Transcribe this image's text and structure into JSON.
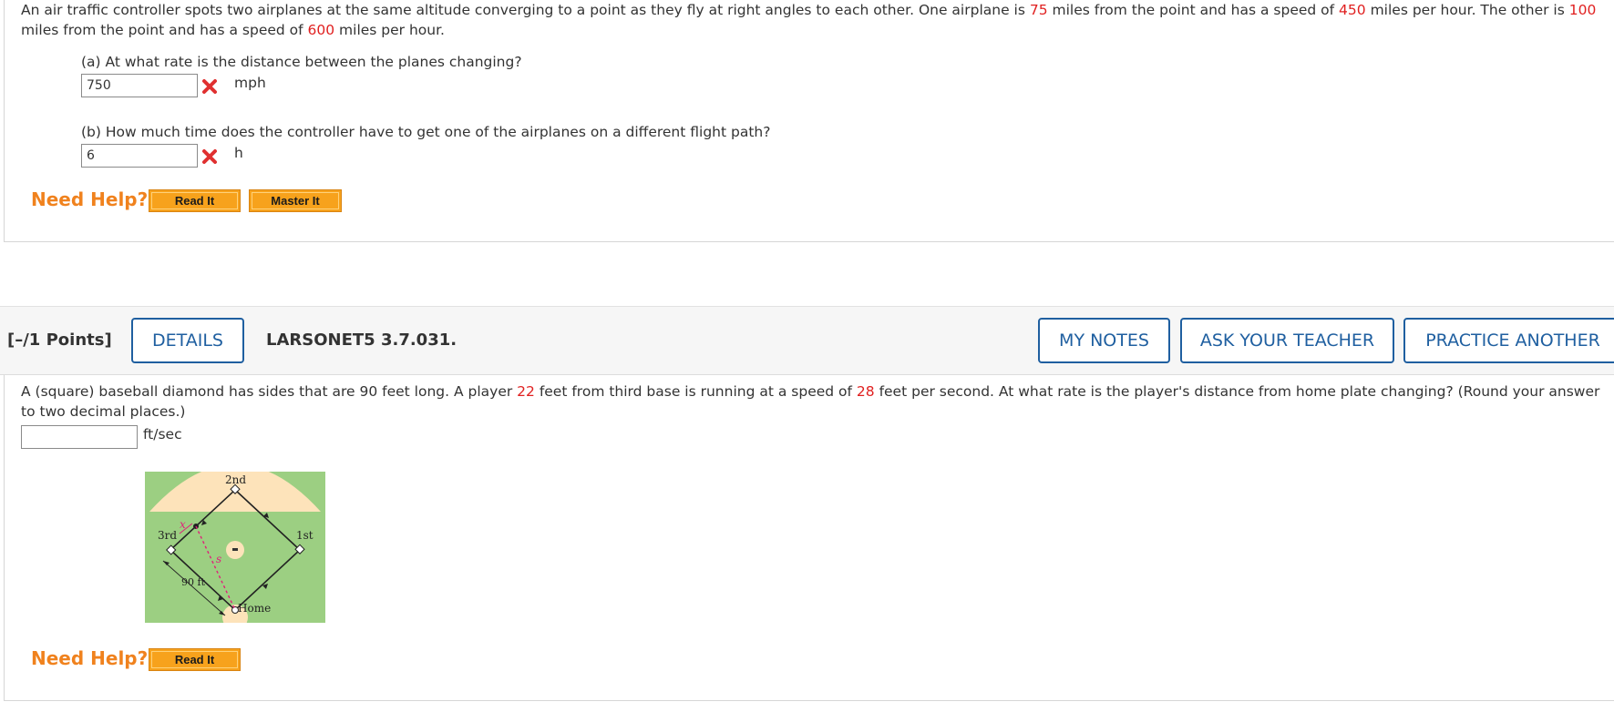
{
  "question1": {
    "stem": {
      "t1": "An air traffic controller spots two airplanes at the same altitude converging to a point as they fly at right angles to each other. One airplane is ",
      "v1": "75",
      "t2": " miles from the point and has a speed of ",
      "v2": "450",
      "t3": " miles per hour. The other is ",
      "v3": "100",
      "t4": " miles from the point and has a speed of ",
      "v4": "600",
      "t5": " miles per hour."
    },
    "part_a": {
      "label": "(a) At what rate is the distance between the planes changing?",
      "value": "750",
      "unit": "mph",
      "status": "incorrect"
    },
    "part_b": {
      "label": "(b) How much time does the controller have to get one of the airplanes on a different flight path?",
      "value": "6",
      "unit": "h",
      "status": "incorrect"
    },
    "help": {
      "label": "Need Help?",
      "read_it": "Read It",
      "master_it": "Master It"
    }
  },
  "question2": {
    "header": {
      "points": "[–/1 Points]",
      "details_button": "DETAILS",
      "question_id": "LARSONET5 3.7.031.",
      "my_notes_button": "MY NOTES",
      "ask_teacher_button": "ASK YOUR TEACHER",
      "practice_another_button": "PRACTICE ANOTHER"
    },
    "stem": {
      "t1": "A (square) baseball diamond has sides that are 90 feet long. A player ",
      "v1": "22",
      "t2": " feet from third base is running at a speed of ",
      "v2": "28",
      "t3": " feet per second. At what rate is the player's distance from home plate changing? (Round your answer to two decimal places.)"
    },
    "answer": {
      "value": "",
      "unit": "ft/sec"
    },
    "diagram": {
      "second": "2nd",
      "third": "3rd",
      "first": "1st",
      "home": "Home",
      "side_label": "90 ft",
      "x_label": "x",
      "s_label": "s"
    },
    "help": {
      "label": "Need Help?",
      "read_it": "Read It"
    }
  },
  "colors": {
    "accent_blue": "#1f5fa0",
    "help_orange": "#f0821e",
    "button_orange": "#f7a21c",
    "value_red": "#e02020",
    "field_green": "#9ccf82",
    "infield_tan": "#fde3ba"
  },
  "icons": {
    "incorrect": "x-mark-icon"
  }
}
